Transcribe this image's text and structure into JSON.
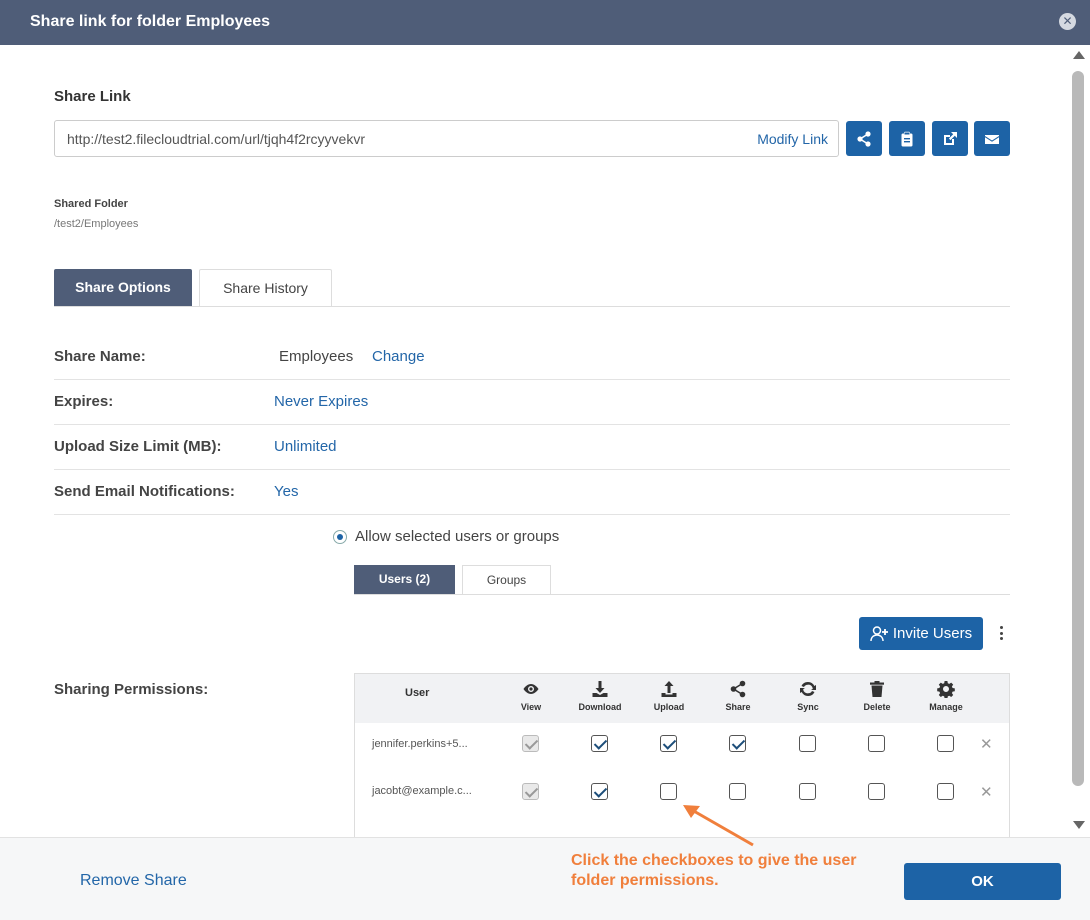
{
  "dialog": {
    "title": "Share link for folder Employees",
    "close_icon": "close-circle-icon"
  },
  "share_link": {
    "label": "Share Link",
    "url": "http://test2.filecloudtrial.com/url/tjqh4f2rcyyvekvr",
    "modify_label": "Modify Link",
    "actions": [
      "share-icon",
      "clipboard-icon",
      "external-link-icon",
      "envelope-icon"
    ]
  },
  "shared_folder": {
    "label": "Shared Folder",
    "path": "/test2/Employees"
  },
  "tabs": {
    "share_options": "Share Options",
    "share_history": "Share History"
  },
  "options": {
    "share_name_label": "Share Name:",
    "share_name_value": "Employees",
    "share_name_change": "Change",
    "expires_label": "Expires:",
    "expires_value": "Never Expires",
    "upload_limit_label": "Upload Size Limit (MB):",
    "upload_limit_value": "Unlimited",
    "email_notif_label": "Send Email Notifications:",
    "email_notif_value": "Yes",
    "allow_option": "Allow selected users or groups"
  },
  "subtabs": {
    "users": "Users (2)",
    "groups": "Groups"
  },
  "invite_button": "Invite Users",
  "permissions": {
    "label": "Sharing Permissions:",
    "user_header": "User",
    "columns": [
      "View",
      "Download",
      "Upload",
      "Share",
      "Sync",
      "Delete",
      "Manage"
    ],
    "users": [
      {
        "name": "jennifer.perkins+5...",
        "perms": [
          true,
          true,
          true,
          true,
          false,
          false,
          false
        ]
      },
      {
        "name": "jacobt@example.c...",
        "perms": [
          true,
          true,
          false,
          false,
          false,
          false,
          false
        ]
      }
    ]
  },
  "annotation": "Click the checkboxes to give the user\nfolder permissions.",
  "footer": {
    "remove_share": "Remove Share",
    "ok": "OK"
  },
  "colors": {
    "header": "#4f5d78",
    "primary": "#1d63a6",
    "link": "#2366a8",
    "annotation": "#f07f3c"
  }
}
